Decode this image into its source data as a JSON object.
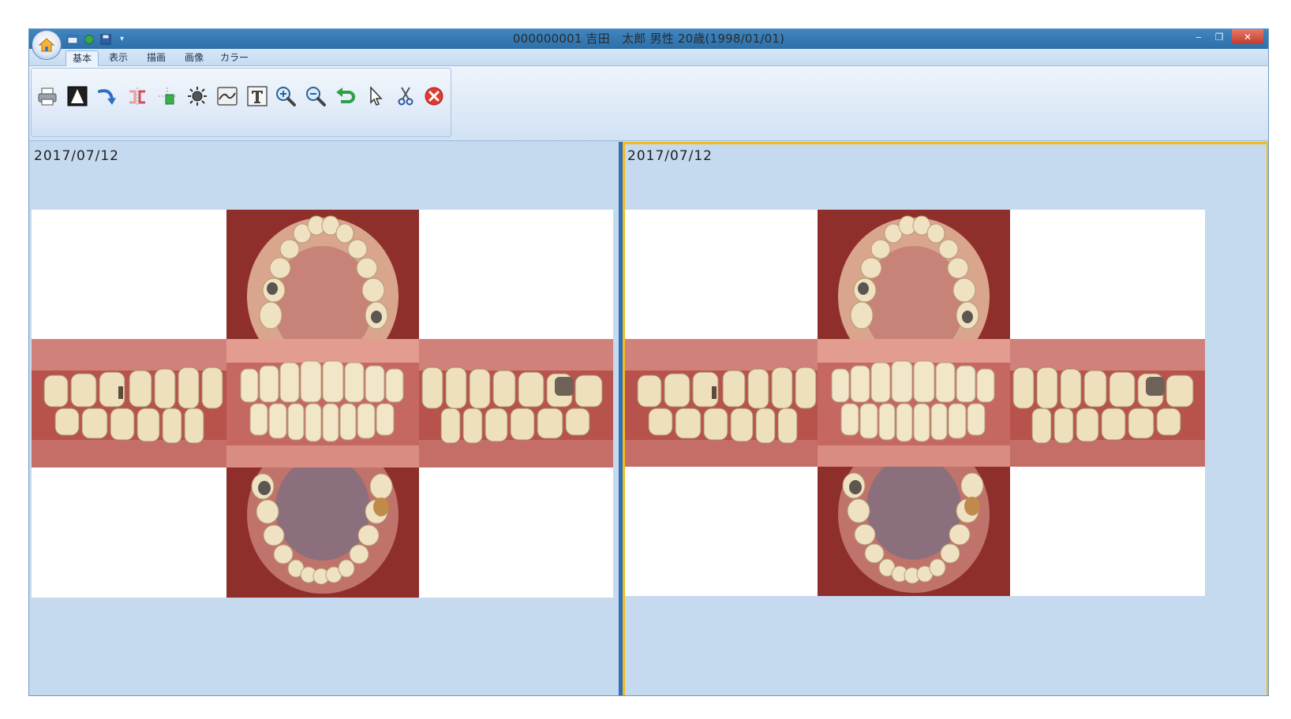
{
  "window": {
    "title": "000000001 吉田　太郎 男性 20歳(1998/01/01)",
    "controls": {
      "minimize": "‒",
      "maximize": "❐",
      "close": "✕"
    }
  },
  "tabs": [
    {
      "label": "基本",
      "active": true
    },
    {
      "label": "表示",
      "active": false
    },
    {
      "label": "描画",
      "active": false
    },
    {
      "label": "画像",
      "active": false
    },
    {
      "label": "カラー",
      "active": false
    }
  ],
  "toolbar": {
    "tools": [
      "print-icon",
      "contrast-icon",
      "rotate-icon",
      "flip-icon",
      "move-icon",
      "brightness-icon",
      "curve-icon",
      "text-icon",
      "zoom-in-icon",
      "zoom-out-icon",
      "undo-icon",
      "pointer-icon",
      "cut-icon",
      "close-icon"
    ]
  },
  "panes": [
    {
      "date": "2017/07/12",
      "selected": false,
      "photos": [
        "upper-occlusal-photo",
        "right-buccal-photo",
        "frontal-photo",
        "left-buccal-photo",
        "lower-occlusal-photo"
      ]
    },
    {
      "date": "2017/07/12",
      "selected": true,
      "photos": [
        "upper-occlusal-photo",
        "right-buccal-photo",
        "frontal-photo",
        "left-buccal-photo",
        "lower-occlusal-photo"
      ]
    }
  ],
  "colors": {
    "pane_background": "#c5d9ef",
    "divider": "#2f6fb5",
    "selection_border": "#f2bc1b",
    "titlebar": "#3f86c0"
  }
}
